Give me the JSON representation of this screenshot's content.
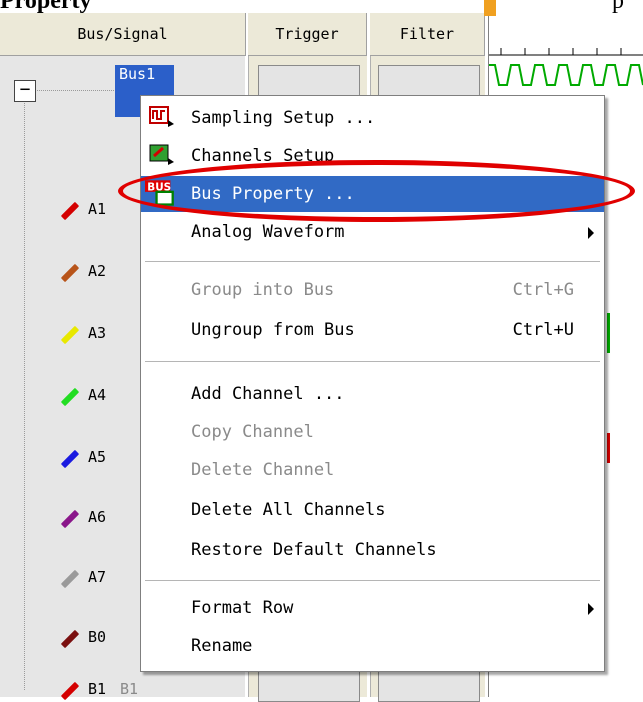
{
  "caption": {
    "bold": "Property",
    "tail": "p"
  },
  "header": {
    "col_bus": "Bus/Signal",
    "col_trigger": "Trigger",
    "col_filter": "Filter"
  },
  "tree": {
    "bus_label": "Bus1",
    "channels": [
      {
        "label": "A1",
        "color": "#d40000"
      },
      {
        "label": "A2",
        "color": "#b8541a"
      },
      {
        "label": "A3",
        "color": "#e8e800"
      },
      {
        "label": "A4",
        "color": "#22dd22"
      },
      {
        "label": "A5",
        "color": "#1a1ae0"
      },
      {
        "label": "A6",
        "color": "#8a168a"
      },
      {
        "label": "A7",
        "color": "#9a9a9a"
      },
      {
        "label": "B0",
        "color": "#7a0f0f"
      },
      {
        "label": "B1",
        "color": "#d40000"
      }
    ],
    "b1_alias": "B1"
  },
  "menu": {
    "items": [
      {
        "label": "Sampling Setup ...",
        "icon": "sampling-icon",
        "disabled": false
      },
      {
        "label": "Channels Setup",
        "icon": "channels-icon",
        "disabled": false
      },
      {
        "label": "Bus Property ...",
        "icon": "bus-icon",
        "disabled": false,
        "highlighted": true
      },
      {
        "label": "Analog Waveform",
        "submenu": true,
        "disabled": false
      },
      {
        "label": "Group into Bus",
        "shortcut": "Ctrl+G",
        "disabled": true
      },
      {
        "label": "Ungroup from Bus",
        "shortcut": "Ctrl+U",
        "disabled": false
      },
      {
        "label": "Add Channel ...",
        "disabled": false
      },
      {
        "label": "Copy Channel",
        "disabled": true
      },
      {
        "label": "Delete Channel",
        "disabled": true
      },
      {
        "label": "Delete All Channels",
        "disabled": false
      },
      {
        "label": "Restore Default Channels",
        "disabled": false
      },
      {
        "label": "Format Row",
        "submenu": true,
        "disabled": false
      },
      {
        "label": "Rename",
        "disabled": false
      }
    ],
    "bus_icon_text": "BUS"
  },
  "colors": {
    "highlight": "#316ac5",
    "annotation": "#e00000",
    "bus_tag": "#2b5fc9",
    "waveform": "#00aa00"
  }
}
